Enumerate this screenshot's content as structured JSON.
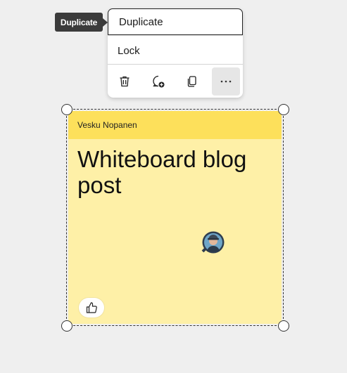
{
  "tooltip": {
    "text": "Duplicate"
  },
  "context_menu": {
    "items": [
      {
        "label": "Duplicate"
      },
      {
        "label": "Lock"
      }
    ],
    "icons": [
      "trash-icon",
      "comment-add-icon",
      "copy-icon",
      "more-options-icon"
    ]
  },
  "note": {
    "author": "Vesku Nopanen",
    "text": "Whiteboard blog post",
    "color": "#fef0a7",
    "header_color": "#fde05b"
  }
}
